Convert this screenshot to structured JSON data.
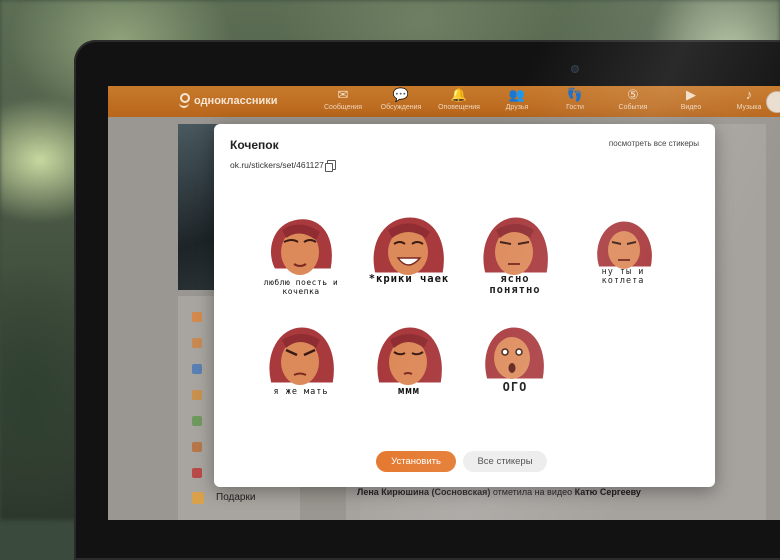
{
  "header": {
    "logo_text": "одноклассники",
    "nav": [
      {
        "label": "Сообщения",
        "icon": "envelope-icon"
      },
      {
        "label": "Обсуждения",
        "icon": "chat-icon"
      },
      {
        "label": "Оповещения",
        "icon": "bell-icon"
      },
      {
        "label": "Друзья",
        "icon": "friends-icon"
      },
      {
        "label": "Гости",
        "icon": "footprints-icon"
      },
      {
        "label": "События",
        "icon": "events-icon"
      },
      {
        "label": "Видео",
        "icon": "video-camera-icon"
      },
      {
        "label": "Музыка",
        "icon": "music-note-icon"
      }
    ]
  },
  "sidebar": {
    "gifts_label": "Подарки"
  },
  "feed": {
    "actor": "Лена Кирюшина (Сосновская)",
    "action": " отметила на видео ",
    "target": "Катю Сергееву"
  },
  "modal": {
    "title": "Кочепок",
    "view_all_link": "посмотреть все стикеры",
    "set_url": "ok.ru/stickers/set/461127",
    "stickers": [
      {
        "caption": "люблю поесть и кочепка"
      },
      {
        "caption": "*крики чаек"
      },
      {
        "caption": "ясно понятно"
      },
      {
        "caption": "ну ты и котлета"
      },
      {
        "caption": "я же мать"
      },
      {
        "caption": "ммм"
      },
      {
        "caption": "ОГО"
      }
    ],
    "install_button": "Установить",
    "all_stickers_button": "Все стикеры"
  },
  "colors": {
    "brand_orange": "#e4772c",
    "hair": "#a8393d",
    "skin": "#dd8a5a"
  }
}
